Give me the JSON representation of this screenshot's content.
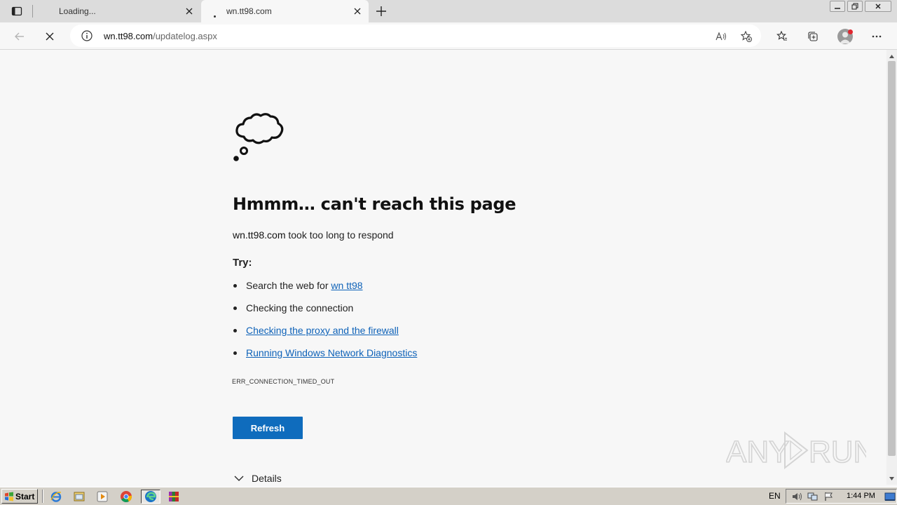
{
  "browser": {
    "tabs": [
      {
        "title": "Loading...",
        "active": false
      },
      {
        "title": "wn.tt98.com",
        "active": true
      }
    ],
    "address": {
      "host": "wn.tt98.com",
      "path": "/updatelog.aspx"
    },
    "profile_badge_color": "#e0262f"
  },
  "error_page": {
    "heading": "Hmmm… can't reach this page",
    "host": "wn.tt98.com",
    "host_message": " took too long to respond",
    "try_label": "Try:",
    "tips": [
      {
        "prefix": "Search the web for ",
        "link": "wn tt98"
      },
      {
        "text": "Checking the connection"
      },
      {
        "link": "Checking the proxy and the firewall"
      },
      {
        "link": "Running Windows Network Diagnostics"
      }
    ],
    "error_code": "ERR_CONNECTION_TIMED_OUT",
    "refresh_label": "Refresh",
    "details_label": "Details",
    "link_color": "#0e62b8",
    "button_color": "#0f6cbd"
  },
  "watermark": {
    "text": "ANY RUN"
  },
  "taskbar": {
    "start_label": "Start",
    "language": "EN",
    "clock": "1:44 PM"
  }
}
